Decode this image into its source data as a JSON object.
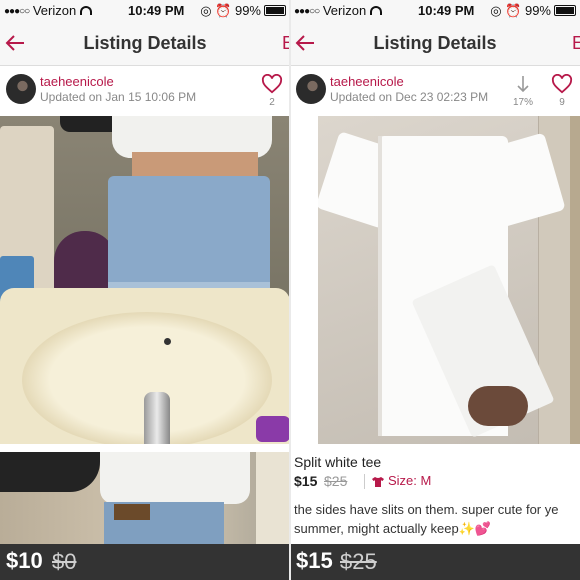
{
  "status": {
    "carrier": "Verizon",
    "time": "10:49 PM",
    "battery": "99%"
  },
  "nav": {
    "title": "Listing Details",
    "edge_left": "E",
    "edge_right": "E"
  },
  "left_listing": {
    "username": "taeheenicole",
    "updated": "Updated on Jan 15 10:06 PM",
    "likes": "2",
    "price": "$10",
    "original_price": "$0"
  },
  "right_listing": {
    "username": "taeheenicole",
    "updated": "Updated on Dec 23 02:23 PM",
    "price_drop": "17%",
    "likes": "9",
    "title": "Split white tee",
    "price": "$15",
    "original_price": "$25",
    "size": "Size: M",
    "description": "the sides have slits on them. super cute for ye",
    "description_line2": "summer, might actually keep✨💕"
  },
  "colors": {
    "accent": "#b7194a",
    "pricebar": "#333333"
  }
}
